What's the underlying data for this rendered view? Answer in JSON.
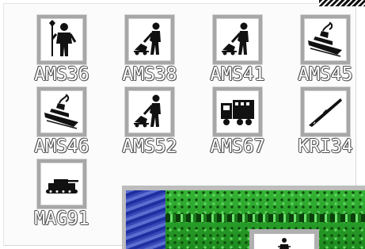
{
  "units": [
    {
      "code": "AMS36",
      "icon": "warrior-icon"
    },
    {
      "code": "AMS38",
      "icon": "engineer-icon"
    },
    {
      "code": "AMS41",
      "icon": "engineer-icon"
    },
    {
      "code": "AMS45",
      "icon": "battleship-icon"
    },
    {
      "code": "AMS46",
      "icon": "battleship-icon"
    },
    {
      "code": "AMS52",
      "icon": "engineer-icon"
    },
    {
      "code": "AMS67",
      "icon": "truck-icon"
    },
    {
      "code": "KRI34",
      "icon": "cruiser-icon"
    },
    {
      "code": "MAG91",
      "icon": "tank-icon"
    }
  ],
  "map_preview": {
    "tiles": [
      "water-tile",
      "grass-tile"
    ],
    "selected_unit_icon": "soldier-icon"
  },
  "colors": {
    "frame": "#a7a7a7",
    "label_outline": "#505050",
    "grass": "#2c8a2c",
    "water": "#1f2fa0"
  }
}
